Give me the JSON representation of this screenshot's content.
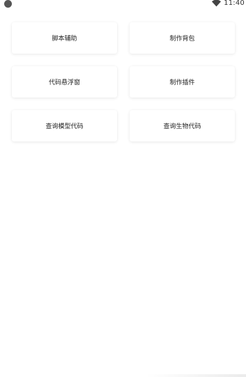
{
  "status_bar": {
    "time": "11:40",
    "icons": [
      "camera-dot-icon",
      "wifi-icon"
    ]
  },
  "menu": {
    "items": [
      {
        "label": "脚本辅助"
      },
      {
        "label": "制作背包"
      },
      {
        "label": "代码悬浮窗"
      },
      {
        "label": "制作插件"
      },
      {
        "label": "查询模型代码"
      },
      {
        "label": "查询生物代码"
      }
    ]
  },
  "colors": {
    "background": "#ffffff",
    "text": "#222222",
    "status_icon": "#555555"
  }
}
